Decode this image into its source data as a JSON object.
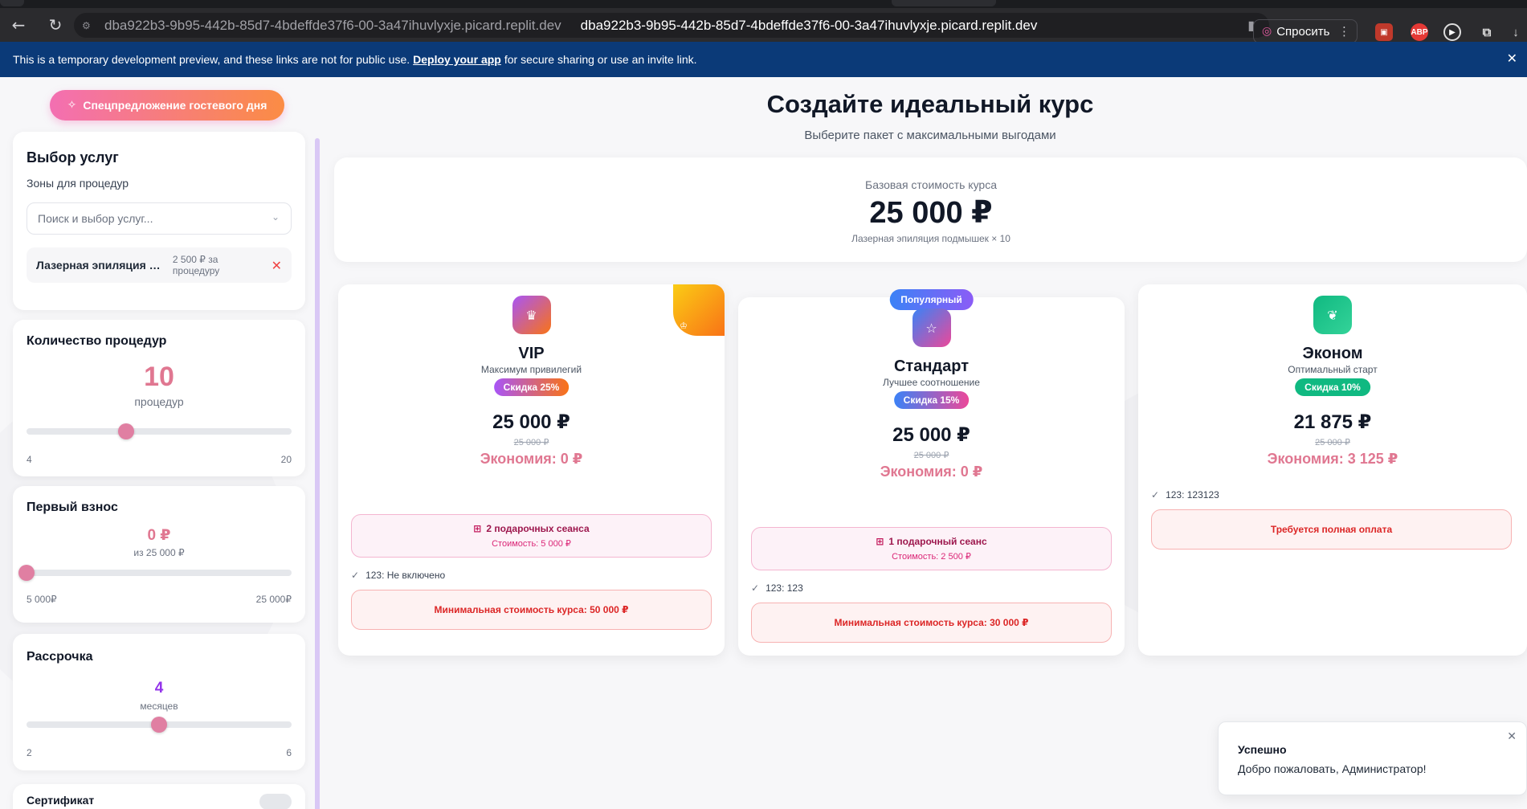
{
  "browser": {
    "url_host": "dba922b3-9b95-442b-85d7-4bdeffde37f6-00-3a47ihuvlyxje.picard.replit.dev",
    "url_title": "dba922b3-9b95-442b-85d7-4bdeffde37f6-00-3a47ihuvlyxje.picard.replit.dev",
    "ask_label": "Спросить",
    "ext_abp": "ABP"
  },
  "banner": {
    "text_before": "This is a temporary development preview, and these links are not for public use.",
    "link": "Deploy your app",
    "text_after": "for secure sharing or use an invite link."
  },
  "promo_label": "Спецпредложение гостевого дня",
  "services": {
    "title": "Выбор услуг",
    "zones_label": "Зоны для процедур",
    "search_placeholder": "Поиск и выбор услуг...",
    "selected": {
      "name": "Лазерная эпиляция подмышек",
      "price": "2 500 ₽ за процедуру"
    }
  },
  "count": {
    "title": "Количество процедур",
    "value": "10",
    "unit": "процедур",
    "min": "4",
    "max": "20",
    "fraction": 0.375
  },
  "payment": {
    "title": "Первый взнос",
    "value": "0 ₽",
    "of": "из 25 000 ₽",
    "min": "5 000₽",
    "max": "25 000₽",
    "fraction": 0.0
  },
  "installment": {
    "title": "Рассрочка",
    "value": "4",
    "unit": "месяцев",
    "min": "2",
    "max": "6",
    "fraction": 0.5
  },
  "certificate": {
    "title": "Сертификат"
  },
  "main": {
    "title": "Создайте идеальный курс",
    "subtitle": "Выберите пакет с максимальными выгодами",
    "base_label": "Базовая стоимость курса",
    "base_price": "25 000 ₽",
    "base_note": "Лазерная эпиляция подмышек × 10"
  },
  "plans": [
    {
      "name": "VIP",
      "desc": "Максимум привилегий",
      "discount": "Скидка 25%",
      "price": "25 000 ₽",
      "old": "25 000 ₽",
      "savings": "Экономия: 0 ₽",
      "gift_title": "2 подарочных сеанса",
      "gift_cost": "Стоимость: 5 000 ₽",
      "feature": "123: Не включено",
      "warning": "Минимальная стоимость курса: 50 000 ₽"
    },
    {
      "name": "Стандарт",
      "badge": "Популярный",
      "desc": "Лучшее соотношение",
      "discount": "Скидка 15%",
      "price": "25 000 ₽",
      "old": "25 000 ₽",
      "savings": "Экономия: 0 ₽",
      "gift_title": "1 подарочный сеанс",
      "gift_cost": "Стоимость: 2 500 ₽",
      "feature": "123: 123",
      "warning": "Минимальная стоимость курса: 30 000 ₽"
    },
    {
      "name": "Эконом",
      "desc": "Оптимальный старт",
      "discount": "Скидка 10%",
      "price": "21 875 ₽",
      "old": "25 000 ₽",
      "savings": "Экономия: 3 125 ₽",
      "feature": "123: 123123",
      "warning": "Требуется полная оплата"
    }
  ],
  "toast": {
    "title": "Успешно",
    "message": "Добро пожаловать, Администратор!"
  },
  "colors": {
    "accent_pink": "#e07fa2",
    "banner": "#0b3a78",
    "installment": "#9333ea"
  }
}
